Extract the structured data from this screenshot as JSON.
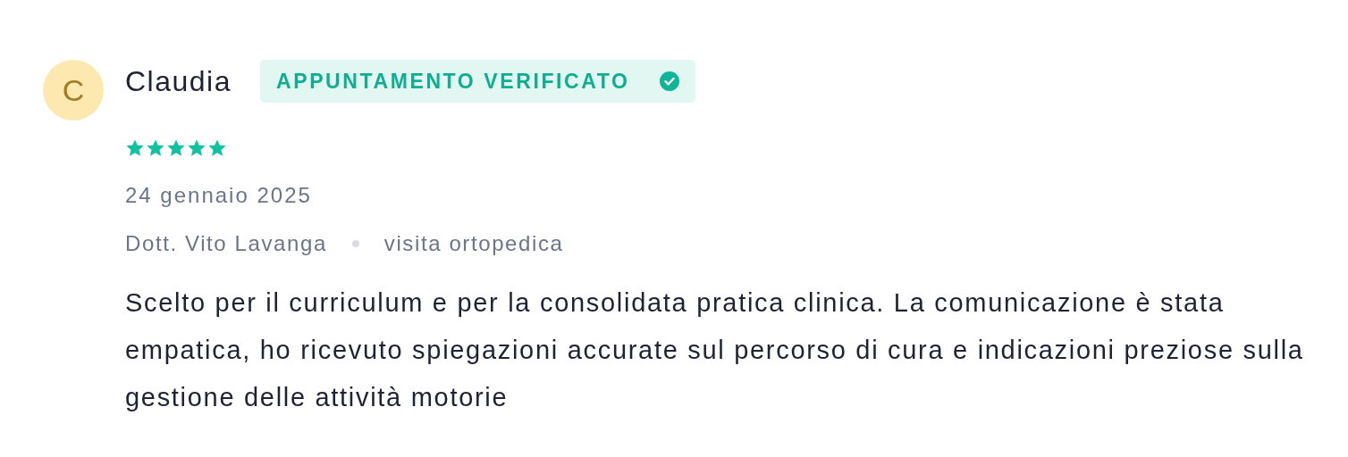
{
  "review": {
    "avatar_letter": "C",
    "name": "Claudia",
    "badge": {
      "label": "APPUNTAMENTO VERIFICATO",
      "verified": true
    },
    "stars": 5,
    "date": "24 gennaio 2025",
    "doctor": "Dott. Vito Lavanga",
    "service": "visita ortopedica",
    "text": "Scelto per il curriculum e per la consolidata pratica clinica. La comunicazione è stata empatica, ho ricevuto spiegazioni accurate sul percorso di cura e indicazioni preziose sulla gestione delle attività motorie"
  }
}
